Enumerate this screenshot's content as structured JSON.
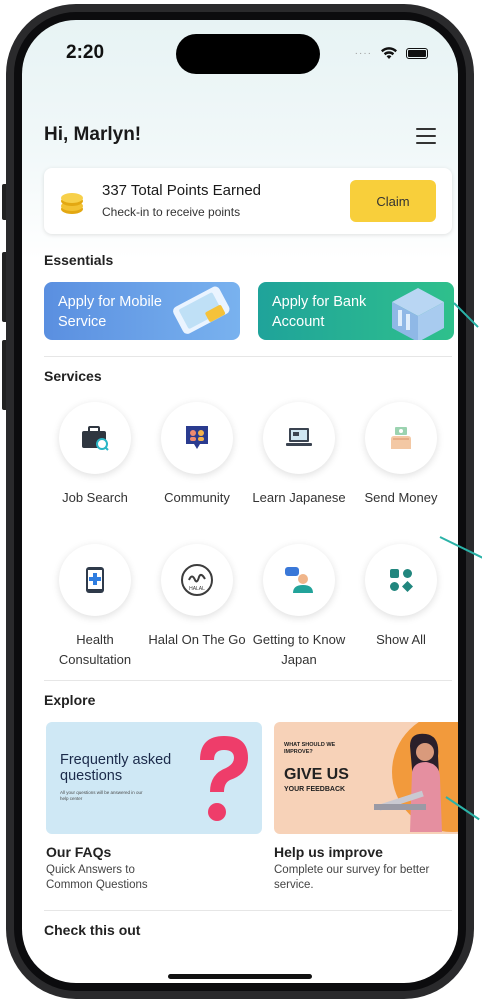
{
  "status_bar": {
    "time": "2:20"
  },
  "header": {
    "greeting": "Hi, Marlyn!"
  },
  "points": {
    "title": "337 Total Points Earned",
    "subtitle": "Check-in to receive points",
    "claim_label": "Claim"
  },
  "essentials": {
    "title": "Essentials",
    "cards": [
      {
        "label": "Apply for Mobile Service"
      },
      {
        "label": "Apply for Bank Account"
      }
    ]
  },
  "services": {
    "title": "Services",
    "items": [
      {
        "label": "Job Search",
        "icon": "briefcase-icon"
      },
      {
        "label": "Community",
        "icon": "community-chat-icon"
      },
      {
        "label": "Learn Japanese",
        "icon": "laptop-icon"
      },
      {
        "label": "Send Money",
        "icon": "money-hand-icon"
      },
      {
        "label": "Health Consultation",
        "icon": "phone-medical-icon"
      },
      {
        "label": "Halal On The Go",
        "icon": "halal-icon"
      },
      {
        "label": "Getting to Know Japan",
        "icon": "person-chat-icon"
      },
      {
        "label": "Show All",
        "icon": "grid-icon"
      }
    ]
  },
  "explore": {
    "title": "Explore",
    "cards": [
      {
        "title": "Our FAQs",
        "subtitle": "Quick Answers to Common Questions",
        "image_text": "Frequently asked questions",
        "image_small": "All your questions will be answered in our help center"
      },
      {
        "title": "Help us improve",
        "subtitle": "Complete our survey for better service.",
        "image_small": "WHAT SHOULD WE IMPROVE?",
        "image_text": "GIVE US",
        "image_sub": "YOUR FEEDBACK"
      }
    ]
  },
  "check_this_out": {
    "title": "Check this out"
  },
  "colors": {
    "accent_yellow": "#f8cf3b",
    "mobile_card": "#5f98e6",
    "bank_card": "#22b39a",
    "teal_line": "#2bb3a8"
  }
}
